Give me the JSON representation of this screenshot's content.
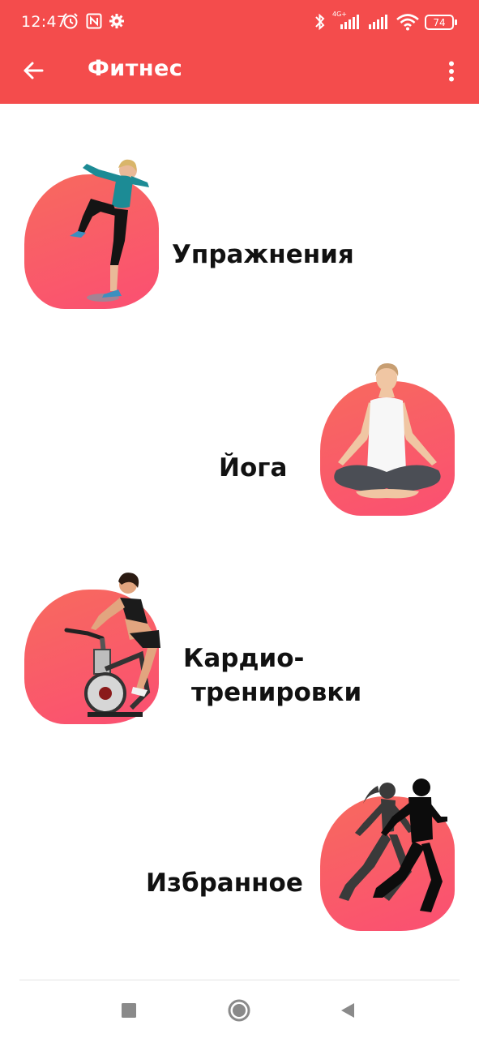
{
  "status_bar": {
    "time": "12:47",
    "battery": "74",
    "network_label": "4G+",
    "icons": [
      "alarm-icon",
      "nfc-icon",
      "settings-icon",
      "bluetooth-icon",
      "signal-icon",
      "signal-icon",
      "wifi-icon",
      "battery-icon"
    ]
  },
  "app_bar": {
    "title": "Фитнес",
    "back_icon": "arrow-back-icon",
    "menu_icon": "more-vert-icon"
  },
  "categories": [
    {
      "label": "Упражнения",
      "image": "woman-exercise-illustration"
    },
    {
      "label": "Йога",
      "image": "woman-yoga-illustration"
    },
    {
      "label_line1": "Кардио-",
      "label_line2": "тренировки",
      "image": "woman-cycling-illustration"
    },
    {
      "label": "Избранное",
      "image": "runners-silhouette-illustration"
    }
  ],
  "nav_bar": {
    "recents_icon": "square-icon",
    "home_icon": "circle-icon",
    "back_icon": "triangle-back-icon"
  },
  "colors": {
    "primary": "#f44c4c",
    "blob_gradient_start": "#f76a5e",
    "blob_gradient_end": "#fb4f72",
    "label_text": "#111111"
  }
}
